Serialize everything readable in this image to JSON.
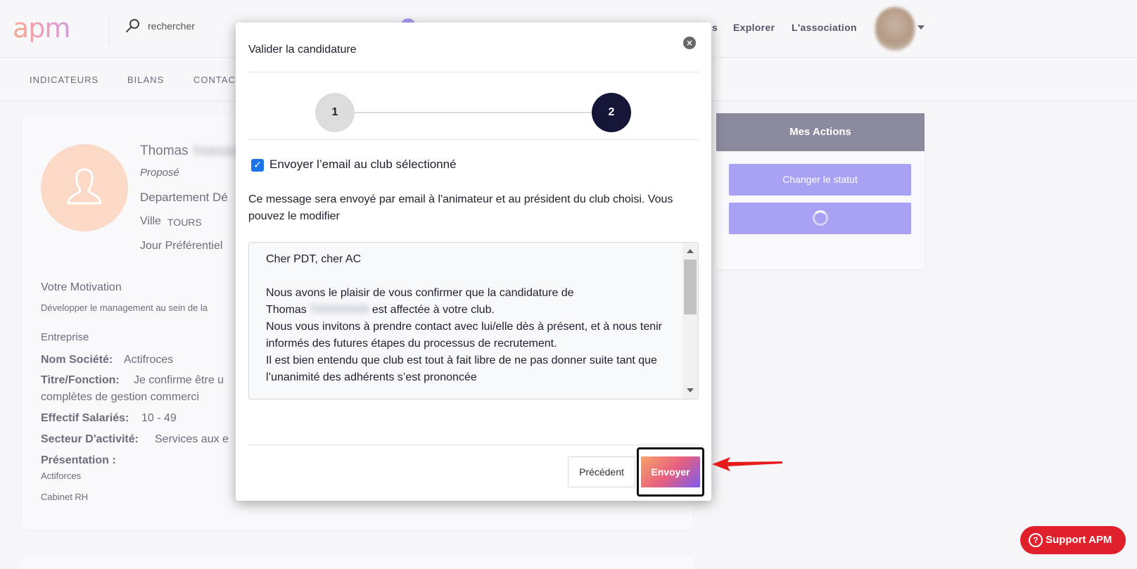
{
  "header": {
    "logo": "apm",
    "search_placeholder": "rechercher",
    "nav_partial": "s",
    "nav_explore": "Explorer",
    "nav_association": "L'association"
  },
  "subnav": {
    "indicators": "INDICATEURS",
    "reports": "BILANS",
    "contacts": "CONTAC"
  },
  "profile": {
    "first_name": "Thomas",
    "last_name": "TXXXXX",
    "status": "Proposé",
    "department_label": "Departement Dé",
    "city_label": "Ville",
    "city_value": "TOURS",
    "preferred_day_label": "Jour Préférentiel",
    "motivation_title": "Votre Motivation",
    "motivation_text": "Développer le management au sein de la",
    "company_title": "Entreprise",
    "company_name_label": "Nom Société:",
    "company_name_value": "Actifroces",
    "title_label": "Titre/Fonction:",
    "title_value_line1": "Je confirme être u",
    "title_value_line2": "complètes de gestion commerci",
    "employees_label": "Effectif Salariés:",
    "employees_value": "10 - 49",
    "sector_label": "Secteur D'activité:",
    "sector_value": "Services aux e",
    "presentation_label": "Présentation :",
    "presentation_line1": "Actiforces",
    "presentation_line2": "Cabinet RH"
  },
  "actions": {
    "title": "Mes Actions",
    "change_status": "Changer le statut"
  },
  "support": {
    "label": "Support APM",
    "icon": "?"
  },
  "modal": {
    "title": "Valider la candidature",
    "close_icon": "×",
    "step1": "1",
    "step2": "2",
    "checkbox_mark": "✓",
    "checkbox_label": "Envoyer l’email au club sélectionné",
    "info_text": "Ce message sera envoyé par email à l'animateur et au président du club choisi. Vous pouvez le modifier",
    "message_greeting": "Cher PDT, cher AC",
    "message_line1": "Nous avons le plaisir de vous confirmer que la candidature de",
    "message_name": "Thomas",
    "message_blur": "TXXXXXXX",
    "message_line2_end": "est affectée à votre club.",
    "message_line3": "Nous vous invitons à prendre contact avec lui/elle dès à présent, et à nous tenir informés des futures étapes du processus de recrutement.",
    "message_line4": "Il est bien entendu que club est tout à fait libre de ne pas donner suite tant que l’unanimité des adhérents s’est prononcée",
    "prev_button": "Précédent",
    "send_button": "Envoyer"
  }
}
